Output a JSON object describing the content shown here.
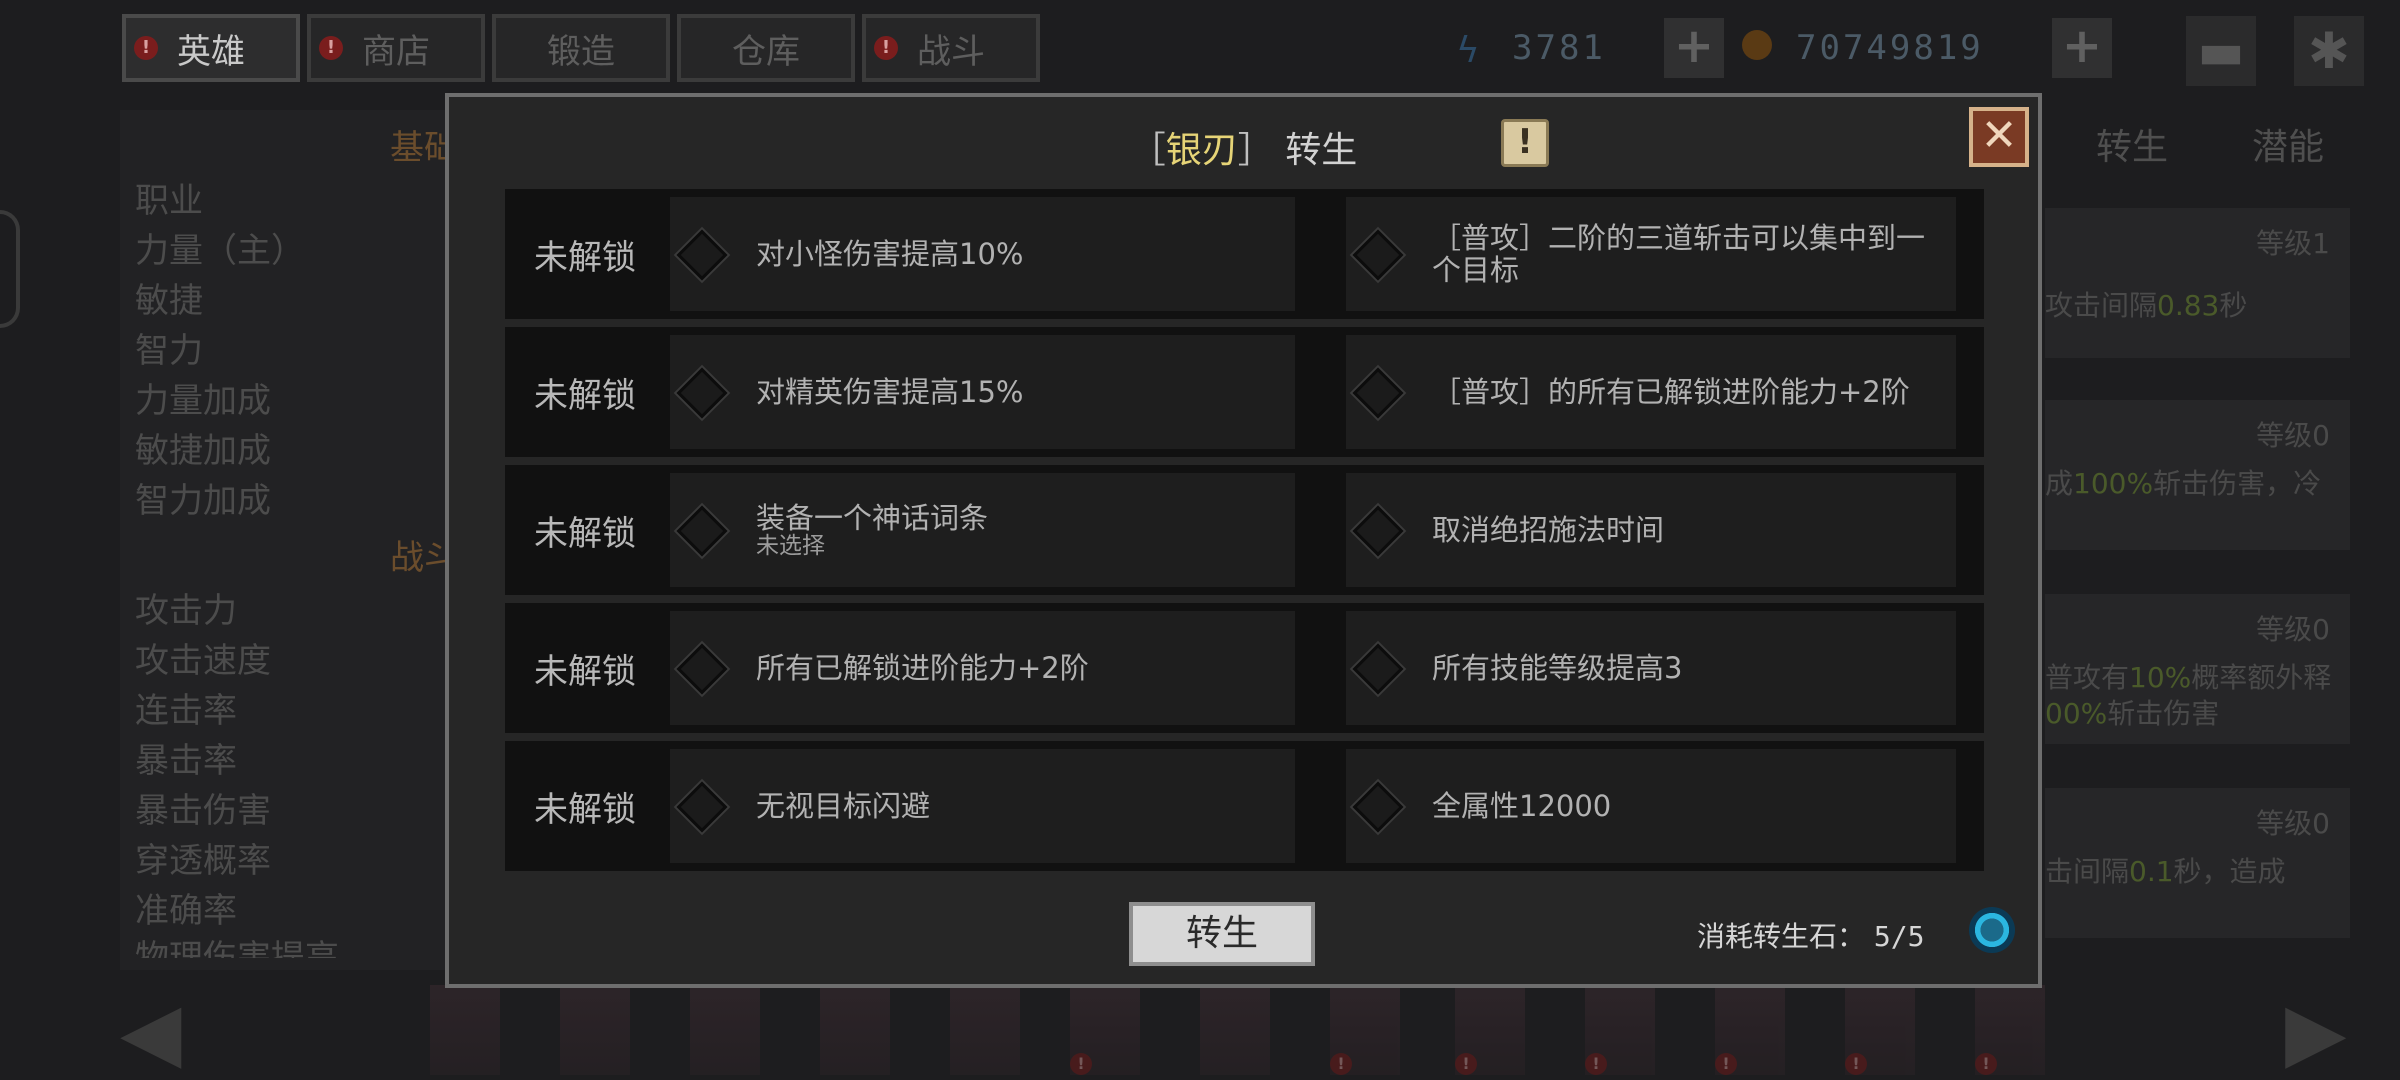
{
  "top_tabs": [
    {
      "label": "英雄",
      "alert": false,
      "active": true
    },
    {
      "label": "商店",
      "alert": true,
      "active": false
    },
    {
      "label": "锻造",
      "alert": false,
      "active": false
    },
    {
      "label": "仓库",
      "alert": false,
      "active": false
    },
    {
      "label": "战斗",
      "alert": true,
      "active": false
    }
  ],
  "alert_symbol": "!",
  "resources": {
    "energy_value": "3781",
    "gold_value": "70749819",
    "plus_symbol": "+"
  },
  "left_panel": {
    "section1_title": "基础",
    "section2_title": "战斗",
    "stats": [
      "职业",
      "力量（主）",
      "敏捷",
      "智力",
      "力量加成",
      "敏捷加成",
      "智力加成"
    ],
    "combat_stats": [
      "攻击力",
      "攻击速度",
      "连击率",
      "暴击率",
      "暴击伤害",
      "穿透概率",
      "准确率",
      "物理伤害提高"
    ]
  },
  "right_panel": {
    "tabs": [
      "转生",
      "潜能"
    ],
    "cards": [
      {
        "level": "等级1",
        "line1_pre": "攻击间隔",
        "line1_hl": "0.83",
        "line1_post": "秒",
        "line2": ""
      },
      {
        "level": "等级0",
        "line1_pre": "成",
        "line1_hl": "100%",
        "line1_post": "斩击伤害，冷",
        "line2": ""
      },
      {
        "level": "等级0",
        "line1_pre": "普攻有",
        "line1_hl": "10%",
        "line1_post": "概率额外释",
        "line2_hl": "00%",
        "line2_post": "斩击伤害"
      },
      {
        "level": "等级0",
        "line1_pre": "击间隔",
        "line1_hl": "0.1",
        "line1_post": "秒，造成",
        "line2": ""
      }
    ]
  },
  "modal": {
    "title_open": "［",
    "title_name": "银刃",
    "title_close": "］",
    "title_suffix": "转生",
    "info_symbol": "!",
    "close_symbol": "✕",
    "rows": [
      {
        "status": "未解锁",
        "left": "对小怪伤害提高10%",
        "right": "［普攻］二阶的三道斩击可以集中到一个目标"
      },
      {
        "status": "未解锁",
        "left": "对精英伤害提高15%",
        "right": "［普攻］的所有已解锁进阶能力+2阶"
      },
      {
        "status": "未解锁",
        "left": "装备一个神话词条",
        "left_sub": "未选择",
        "right": "取消绝招施法时间"
      },
      {
        "status": "未解锁",
        "left": "所有已解锁进阶能力+2阶",
        "right": "所有技能等级提高3"
      },
      {
        "status": "未解锁",
        "left": "无视目标闪避",
        "right": "全属性12000"
      }
    ],
    "rebirth_button": "转生",
    "cost_label": "消耗转生石：",
    "cost_value": "5/5"
  },
  "colors": {
    "accent_gold": "#e6d477",
    "close_bg": "#7a3a24",
    "stone_cyan": "#2bb6e0"
  },
  "icons": [
    "alert-icon",
    "energy-icon",
    "coin-icon",
    "plus-icon",
    "gamepad-icon",
    "gear-icon",
    "info-icon",
    "close-icon",
    "diamond-icon",
    "rebirth-stone-icon",
    "arrow-left-icon",
    "arrow-right-icon"
  ]
}
